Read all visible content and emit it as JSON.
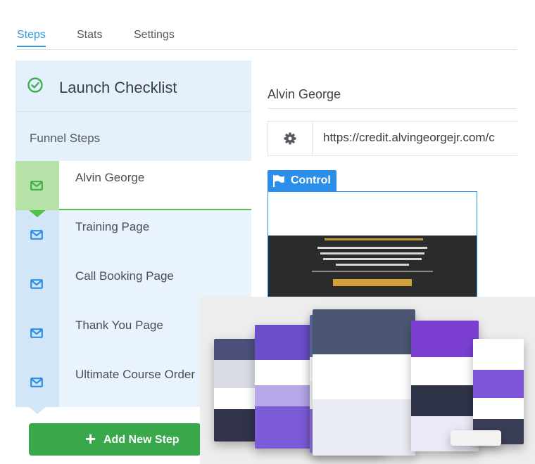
{
  "tabs": [
    {
      "label": "Steps",
      "active": true
    },
    {
      "label": "Stats",
      "active": false
    },
    {
      "label": "Settings",
      "active": false
    }
  ],
  "sidebar": {
    "title": "Launch Checklist",
    "subtitle": "Funnel Steps",
    "steps": [
      {
        "label": "Alvin George",
        "icon": "envelope-icon",
        "selected": true
      },
      {
        "label": "Training Page",
        "icon": "envelope-icon",
        "selected": false
      },
      {
        "label": "Call Booking Page",
        "icon": "envelope-icon",
        "selected": false
      },
      {
        "label": "Thank You Page",
        "icon": "envelope-icon",
        "selected": false
      },
      {
        "label": "Ultimate Course Order",
        "icon": "envelope-icon",
        "selected": false
      }
    ],
    "add_button": "Add New Step"
  },
  "main": {
    "page_name": "Alvin George",
    "url": "https://credit.alvingeorgejr.com/c",
    "control_label": "Control"
  },
  "colors": {
    "accent_blue": "#2f9be3",
    "add_green": "#38a84a",
    "selected_green": "#4ec34b",
    "sidebar_bg": "#e4f1fd"
  }
}
